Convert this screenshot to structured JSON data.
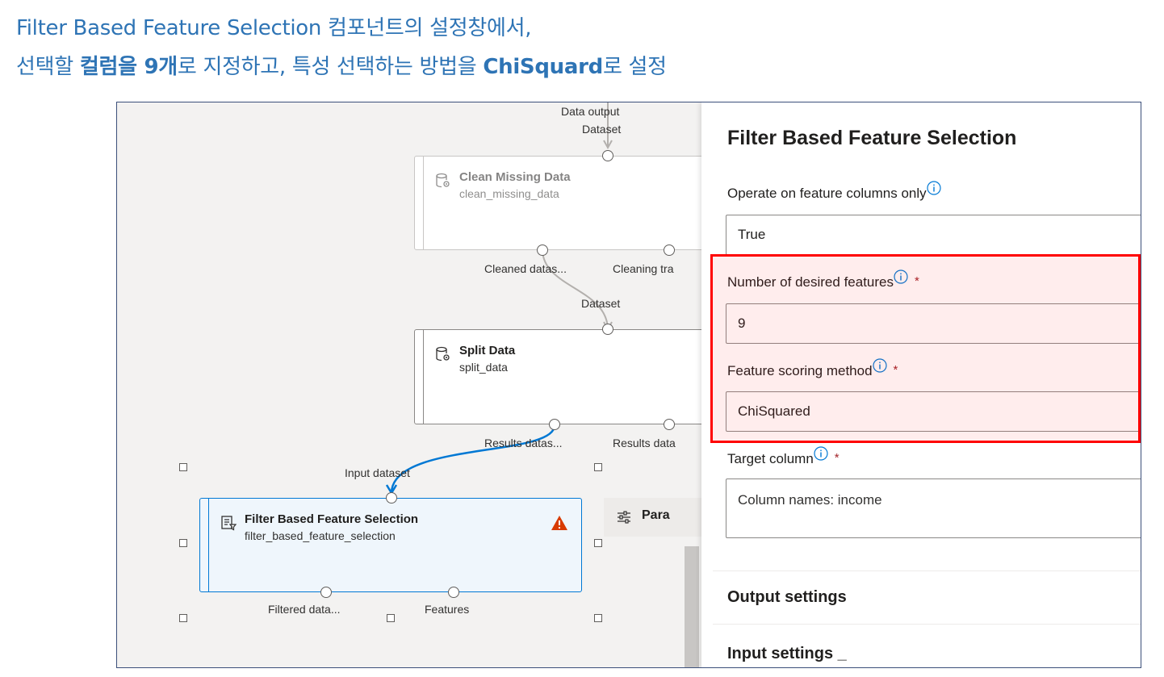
{
  "caption": {
    "line1": "Filter Based Feature Selection 컴포넌트의 설정창에서,",
    "line2_pre": "선택할 ",
    "line2_b1": "컬럼을 9개",
    "line2_mid": "로 지정하고, 특성 선택하는 방법을 ",
    "line2_b2": "ChiSquard",
    "line2_post": "로 설정"
  },
  "canvas": {
    "top_labels": {
      "data_output": "Data output",
      "dataset": "Dataset"
    },
    "clean_node": {
      "title": "Clean Missing Data",
      "subtitle": "clean_missing_data",
      "icon": "dataset-module-icon",
      "out_label_1": "Cleaned datas...",
      "out_label_2": "Cleaning tra"
    },
    "split_node": {
      "in_label": "Dataset",
      "title": "Split Data",
      "subtitle": "split_data",
      "icon": "dataset-module-icon",
      "out_label_1": "Results datas...",
      "out_label_2": "Results data"
    },
    "filter_node": {
      "in_label": "Input dataset",
      "title": "Filter Based Feature Selection",
      "subtitle": "filter_based_feature_selection",
      "icon": "document-filter-icon",
      "status_icon": "warning-icon",
      "out_label_1": "Filtered data...",
      "out_label_2": "Features"
    },
    "params_tab": {
      "label": "Para",
      "icon": "sliders-icon"
    }
  },
  "panel": {
    "title": "Filter Based Feature Selection",
    "fields": {
      "operate": {
        "label": "Operate on feature columns only",
        "value": "True"
      },
      "num_features": {
        "label": "Number of desired features",
        "value": "9",
        "required": "*"
      },
      "scoring": {
        "label": "Feature scoring method",
        "value": "ChiSquared",
        "required": "*"
      },
      "target": {
        "label": "Target column",
        "value": "Column names: income",
        "required": "*"
      }
    },
    "sections": {
      "output": "Output settings",
      "input": "Input settings _"
    }
  },
  "colors": {
    "caption_blue": "#2e74b5",
    "highlight_red": "#ff0000",
    "selected_blue": "#0078d4",
    "warning_red": "#d83b01"
  }
}
